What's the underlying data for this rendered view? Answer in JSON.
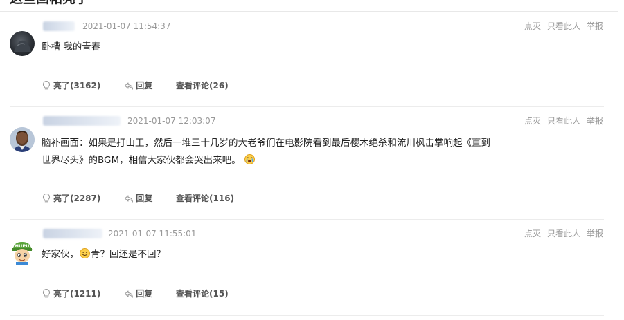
{
  "section": {
    "title": "这些回帖亮了"
  },
  "replies": [
    {
      "time": "2021-01-07 11:54:37",
      "content": "卧槽 我的青春",
      "actions": {
        "mute": "点灭",
        "only_this": "只看此人",
        "report": "举报"
      },
      "light": "亮了(3162)",
      "reply": "回复",
      "comments": "查看评论(26)"
    },
    {
      "time": "2021-01-07 12:03:07",
      "content_line1": "脑补画面：如果是打山王，然后一堆三十几岁的大老爷们在电影院看到最后樱木绝杀和流川枫击掌响起《直到",
      "content_line2": "世界尽头》的BGM，相信大家伙都会哭出来吧。",
      "actions": {
        "mute": "点灭",
        "only_this": "只看此人",
        "report": "举报"
      },
      "light": "亮了(2287)",
      "reply": "回复",
      "comments": "查看评论(116)"
    },
    {
      "time": "2021-01-07 11:55:01",
      "content_a": "好家伙，",
      "content_b": "青？回还是不回？",
      "actions": {
        "mute": "点灭",
        "only_this": "只看此人",
        "report": "举报"
      },
      "light": "亮了(1211)",
      "reply": "回复",
      "comments": "查看评论(15)",
      "avatar_text": "HUPU"
    }
  ],
  "icons": {
    "light": "lightbulb-icon",
    "reply": "reply-arrow-icon",
    "crying_emoji": "crying-face-emoji",
    "smile_emoji": "smiling-face-emoji"
  }
}
